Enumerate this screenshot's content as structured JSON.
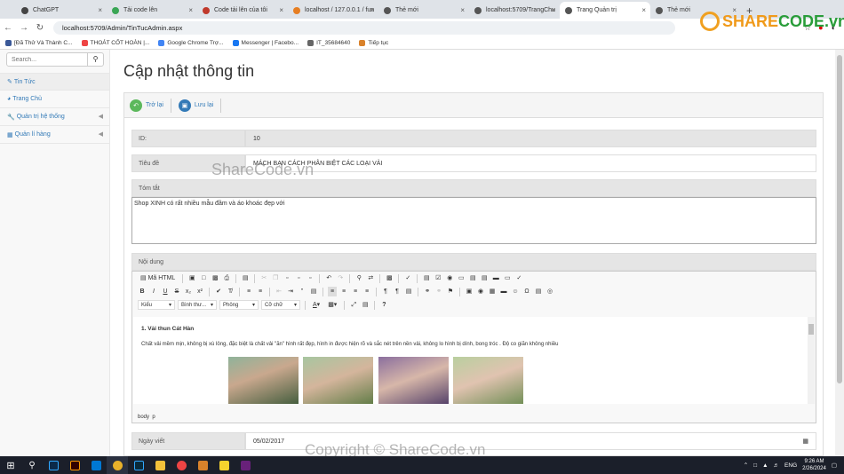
{
  "browser": {
    "tabs": [
      {
        "title": "ChatGPT",
        "color": "#444"
      },
      {
        "title": "Tải code lên",
        "color": "#3aa655"
      },
      {
        "title": "Code tải lên của tôi",
        "color": "#c0392b"
      },
      {
        "title": "localhost / 127.0.0.1 / fun",
        "color": "#e67e22"
      },
      {
        "title": "Thẻ mới",
        "color": "#555"
      },
      {
        "title": "localhost:5709/TrangChu",
        "color": "#555"
      },
      {
        "title": "Trang Quản trị",
        "color": "#555"
      },
      {
        "title": "Thẻ mới",
        "color": "#555"
      }
    ],
    "url": "localhost:5709/Admin/TinTucAdmin.aspx",
    "bookmarks": [
      "[Đã Thử Và Thành C...",
      "THOÁT CỐT HOÀN |...",
      "Google Chrome Trợ...",
      "Messenger | Facebo...",
      "IT_35684640",
      "Tiếp tục"
    ]
  },
  "sidebar": {
    "search_placeholder": "Search...",
    "items": [
      {
        "label": "Tin Tức",
        "icon": "edit-icon"
      },
      {
        "label": "Trang Chủ",
        "icon": "dashboard-icon"
      },
      {
        "label": "Quản trị hệ thống",
        "icon": "wrench-icon"
      },
      {
        "label": "Quản lí hàng",
        "icon": "table-icon"
      }
    ]
  },
  "page": {
    "title": "Cập nhật thông tin",
    "back_label": "Trở lại",
    "save_label": "Lưu lại"
  },
  "form": {
    "id_label": "ID:",
    "id_value": "10",
    "title_label": "Tiêu đề",
    "title_value": "MÁCH BẠN CÁCH PHÂN BIỆT CÁC LOẠI VẢI",
    "summary_label": "Tóm tắt",
    "summary_value": "Shop XINH có rất nhiều mẫu đầm và áo khoác đẹp với",
    "content_label": "Nội dung",
    "date_label": "Ngày viết",
    "date_value": "05/02/2017"
  },
  "editor": {
    "source_label": "Mã HTML",
    "format_dd": "Kiểu",
    "style_dd": "Bình thư...",
    "font_dd": "Phông",
    "size_dd": "Cỡ chữ",
    "heading": "1. Vải thun Cát Hàn",
    "paragraph": "Chất vải mềm mịn, không bị xù lông, đặc biệt là chất vải \"ăn\" hình rất đẹp, hình in được hiện rõ và sắc nét trên nền vải, không lo hình bị dính, bong tróc . Độ co giãn không nhiều",
    "path_body": "body",
    "path_p": "p"
  },
  "watermark": {
    "text1": "ShareCode.vn",
    "text2": "Copyright © ShareCode.vn",
    "logo_share": "SHARE",
    "logo_code": "CODE.vn"
  },
  "taskbar": {
    "lang": "ENG",
    "time": "9:26 AM",
    "date": "2/26/2024"
  }
}
